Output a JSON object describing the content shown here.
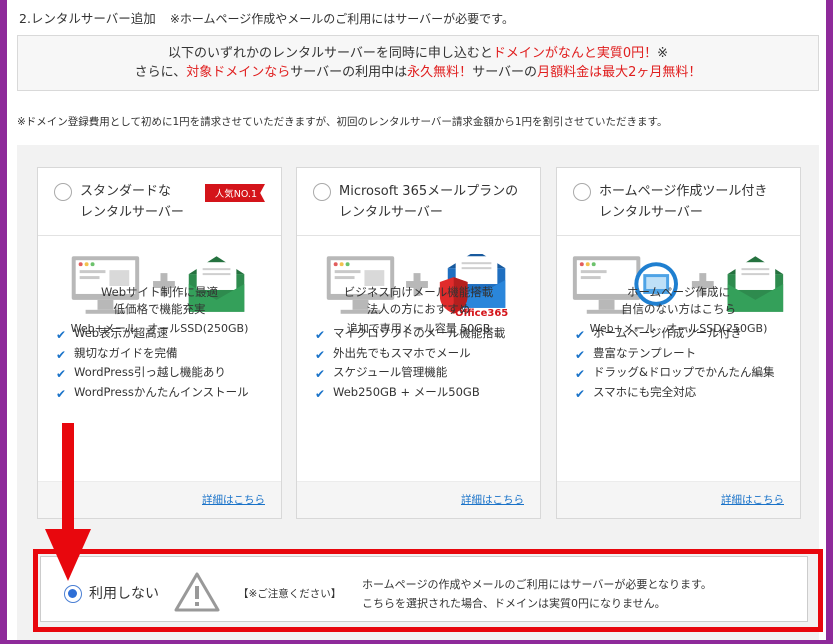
{
  "section": {
    "title": "2.レンタルサーバー追加",
    "note": "※ホームページ作成やメールのご利用にはサーバーが必要です。"
  },
  "promo": {
    "line1_a": "以下のいずれかのレンタルサーバーを同時に申し込むと",
    "line1_b": "ドメインがなんと実質0円！",
    "line1_c": "※",
    "line2_a": "さらに、",
    "line2_b": "対象ドメインなら",
    "line2_c": "サーバーの利用中は",
    "line2_d": "永久無料！",
    "line2_e": "サーバーの",
    "line2_f": "月額料金は最大2ヶ月無料！"
  },
  "fee_note": "※ドメイン登録費用として初めに1円を請求させていただきますが、初回のレンタルサーバー請求金額から1円を割引させていただきます。",
  "plans": [
    {
      "title_line1": "スタンダードな",
      "title_line2": "レンタルサーバー",
      "badge": "人気NO.1",
      "cap_left": "Web+メール",
      "cap_right": "オールSSD(250GB)",
      "desc_line1": "Webサイト制作に最適",
      "desc_line2": "低価格で機能充実",
      "features": [
        "Web表示が超高速",
        "親切なガイドを完備",
        "WordPress引っ越し機能あり",
        "WordPressかんたんインストール"
      ],
      "link": "詳細はこちら"
    },
    {
      "title_line1": "Microsoft 365メールプランの",
      "title_line2": "レンタルサーバー",
      "brand": "Office365",
      "cap": "追加で専用メール容量 50GB",
      "desc_line1": "ビジネス向けメール機能搭載",
      "desc_line2": "法人の方におすすめ",
      "features": [
        "マイクロソフトのメール機能搭載",
        "外出先でもスマホでメール",
        "スケジュール管理機能",
        "Web250GB + メール50GB"
      ],
      "link": "詳細はこちら"
    },
    {
      "title_line1": "ホームページ作成ツール付き",
      "title_line2": "レンタルサーバー",
      "cap_left": "Web+メール",
      "cap_right": "オールSSD(250GB)",
      "desc_line1": "ホームページ作成に",
      "desc_line2": "自信のない方はこちら",
      "features": [
        "ホームページ作成ツール付き",
        "豊富なテンプレート",
        "ドラッグ&ドロップでかんたん編集",
        "スマホにも完全対応"
      ],
      "link": "詳細はこちら"
    }
  ],
  "not_use": {
    "label": "利用しない",
    "caution": "【※ご注意ください】",
    "msg_line1": "ホームページの作成やメールのご利用にはサーバーが必要となります。",
    "msg_line2": "こちらを選択された場合、ドメインは実質0円になりません。",
    "selected": true
  },
  "icons": {
    "check": "check-icon",
    "monitor": "monitor-icon",
    "plus": "plus-icon",
    "envelope": "envelope-icon",
    "shield": "shield-icon",
    "warning": "warning-icon",
    "arrow": "down-arrow-icon"
  },
  "colors": {
    "accent_red": "#e01e1e",
    "link_blue": "#1a73c9",
    "frame_red": "#e8070d",
    "background_purple": "#8e2a9a",
    "envelope_green": "#2e8b4e",
    "envelope_blue": "#1f6fc0"
  }
}
